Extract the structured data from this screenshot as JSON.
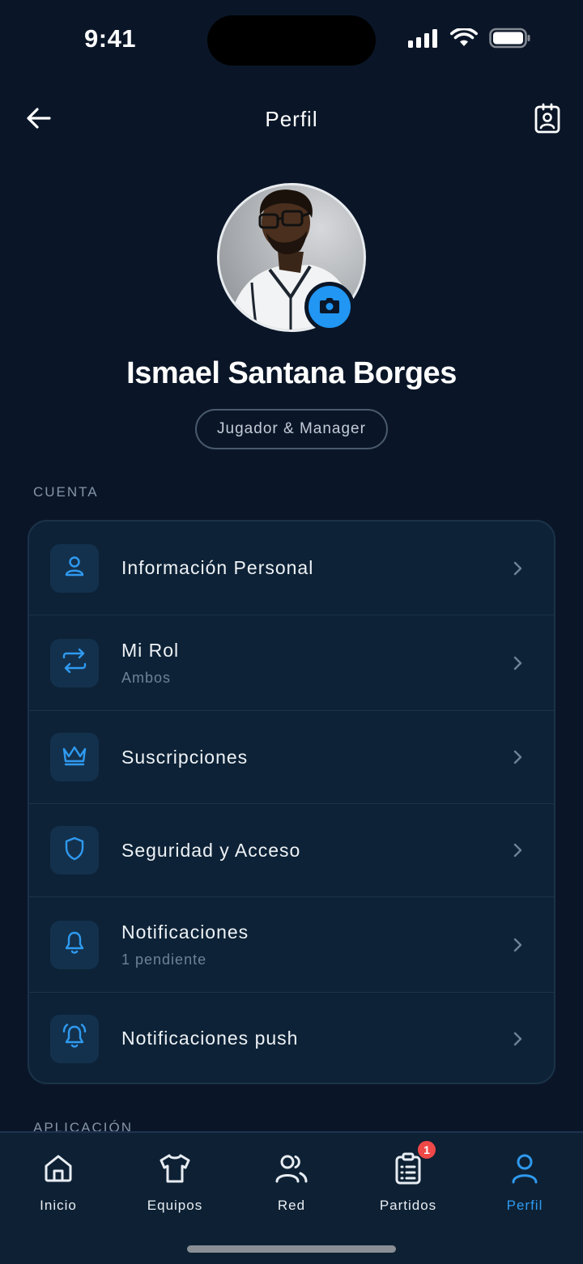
{
  "status": {
    "time": "9:41"
  },
  "header": {
    "title": "Perfil",
    "back_icon": "arrow-left-icon",
    "right_icon": "id-badge-icon"
  },
  "profile": {
    "name": "Ismael Santana Borges",
    "role": "Jugador & Manager",
    "camera_icon": "camera-icon"
  },
  "sections": {
    "account_label": "CUENTA",
    "app_label": "APLICACIÓN"
  },
  "account_items": [
    {
      "title": "Información Personal",
      "subtitle": "",
      "icon": "user-icon"
    },
    {
      "title": "Mi Rol",
      "subtitle": "Ambos",
      "icon": "swap-arrows-icon"
    },
    {
      "title": "Suscripciones",
      "subtitle": "",
      "icon": "crown-icon"
    },
    {
      "title": "Seguridad y Acceso",
      "subtitle": "",
      "icon": "shield-icon"
    },
    {
      "title": "Notificaciones",
      "subtitle": "1 pendiente",
      "icon": "bell-icon"
    },
    {
      "title": "Notificaciones push",
      "subtitle": "",
      "icon": "bell-ring-icon"
    }
  ],
  "tabs": [
    {
      "label": "Inicio",
      "icon": "home-icon",
      "active": false
    },
    {
      "label": "Equipos",
      "icon": "shirt-icon",
      "active": false
    },
    {
      "label": "Red",
      "icon": "users-icon",
      "active": false
    },
    {
      "label": "Partidos",
      "icon": "clipboard-list-icon",
      "active": false,
      "badge": "1"
    },
    {
      "label": "Perfil",
      "icon": "user-icon",
      "active": true
    }
  ],
  "colors": {
    "background": "#0a1628",
    "card": "#0d2236",
    "accent": "#2196f3",
    "badge": "#ef4848",
    "muted": "#6f8196"
  }
}
